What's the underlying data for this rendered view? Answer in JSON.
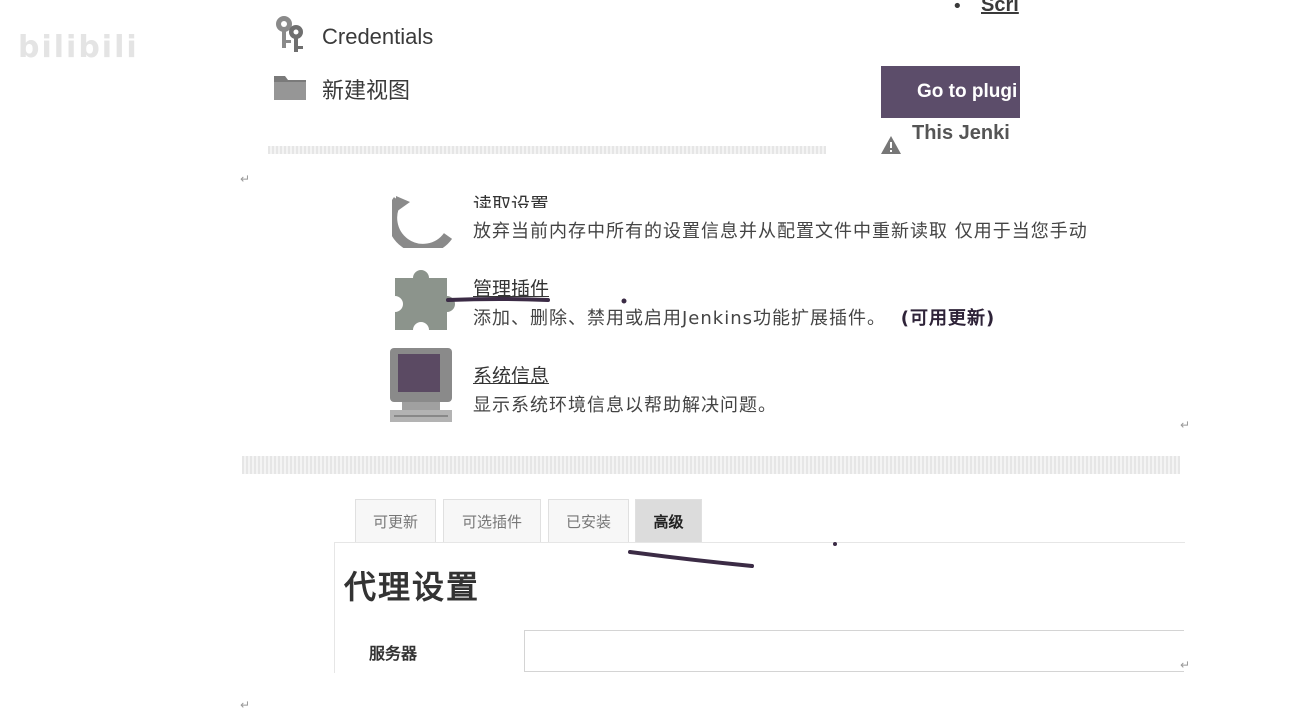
{
  "watermark": "bilibili",
  "sidebar": {
    "items": [
      {
        "label": "Credentials",
        "icon": "keys-icon"
      },
      {
        "label": "新建视图",
        "icon": "folder-icon"
      }
    ]
  },
  "top_right": {
    "link_label": "Scri",
    "plugin_button_label": "Go to plugi",
    "warning_text": "This Jenki"
  },
  "manage": {
    "items": [
      {
        "title": "读取设置",
        "desc": "放弃当前内存中所有的设置信息并从配置文件中重新读取 仅用于当您手动",
        "icon": "reload-icon"
      },
      {
        "title": "管理插件",
        "desc": "添加、删除、禁用或启用Jenkins功能扩展插件。",
        "badge": "(可用更新)",
        "icon": "puzzle-icon"
      },
      {
        "title": "系统信息",
        "desc": "显示系统环境信息以帮助解决问题。",
        "icon": "computer-icon"
      }
    ]
  },
  "tabs": [
    {
      "label": "可更新",
      "active": false
    },
    {
      "label": "可选插件",
      "active": false
    },
    {
      "label": "已安装",
      "active": false
    },
    {
      "label": "高级",
      "active": true
    }
  ],
  "proxy": {
    "title": "代理设置",
    "server_label": "服务器",
    "server_value": ""
  },
  "colors": {
    "button_bg": "#5c4d6a",
    "active_tab_bg": "#dcdcdc",
    "annotation_ink": "#3b2b45"
  }
}
